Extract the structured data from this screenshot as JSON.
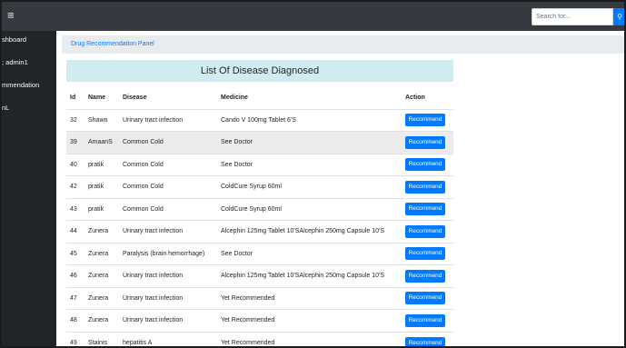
{
  "topbar": {
    "menu_icon": "hamburger-icon",
    "search_placeholder": "Search for...",
    "search_icon": "search-icon",
    "accent": "#007bff"
  },
  "sidebar": {
    "items": [
      {
        "label": "shboard"
      },
      {
        "label": "; admin1"
      },
      {
        "label": "mmendation"
      },
      {
        "label": "nL"
      }
    ]
  },
  "breadcrumb": {
    "current": "Drug Recommendation Panel"
  },
  "panel": {
    "title": "List Of Disease Diagnosed"
  },
  "table": {
    "headers": {
      "id": "Id",
      "name": "Name",
      "disease": "Disease",
      "medicine": "Medicine",
      "action": "Action"
    },
    "action_label": "Recommend",
    "rows": [
      {
        "id": "32",
        "name": "Shawn",
        "disease": "Urinary tract infection",
        "medicine": "Cando V 100mg Tablet 6'S"
      },
      {
        "id": "39",
        "name": "AmaanS",
        "disease": "Common Cold",
        "medicine": "See Doctor"
      },
      {
        "id": "40",
        "name": "pratik",
        "disease": "Common Cold",
        "medicine": "See Doctor"
      },
      {
        "id": "42",
        "name": "pratik",
        "disease": "Common Cold",
        "medicine": "ColdCure Syrup 60ml"
      },
      {
        "id": "43",
        "name": "pratik",
        "disease": "Common Cold",
        "medicine": "ColdCure Syrup 60ml"
      },
      {
        "id": "44",
        "name": "Zunera",
        "disease": "Urinary tract infection",
        "medicine": "Alcephin 125mg Tablet 10'SAlcephin 250mg Capsule 10'S"
      },
      {
        "id": "45",
        "name": "Zunera",
        "disease": "Paralysis (brain hemorrhage)",
        "medicine": "See Doctor"
      },
      {
        "id": "46",
        "name": "Zunera",
        "disease": "Urinary tract infection",
        "medicine": "Alcephin 125mg Tablet 10'SAlcephin 250mg Capsule 10'S"
      },
      {
        "id": "47",
        "name": "Zunera",
        "disease": "Urinary tract infection",
        "medicine": "Yet Recommended"
      },
      {
        "id": "48",
        "name": "Zunera",
        "disease": "Urinary tract infection",
        "medicine": "Yet Recommended"
      },
      {
        "id": "49",
        "name": "Stainis",
        "disease": "hepatitis A",
        "medicine": "Yet Recommended"
      }
    ]
  }
}
